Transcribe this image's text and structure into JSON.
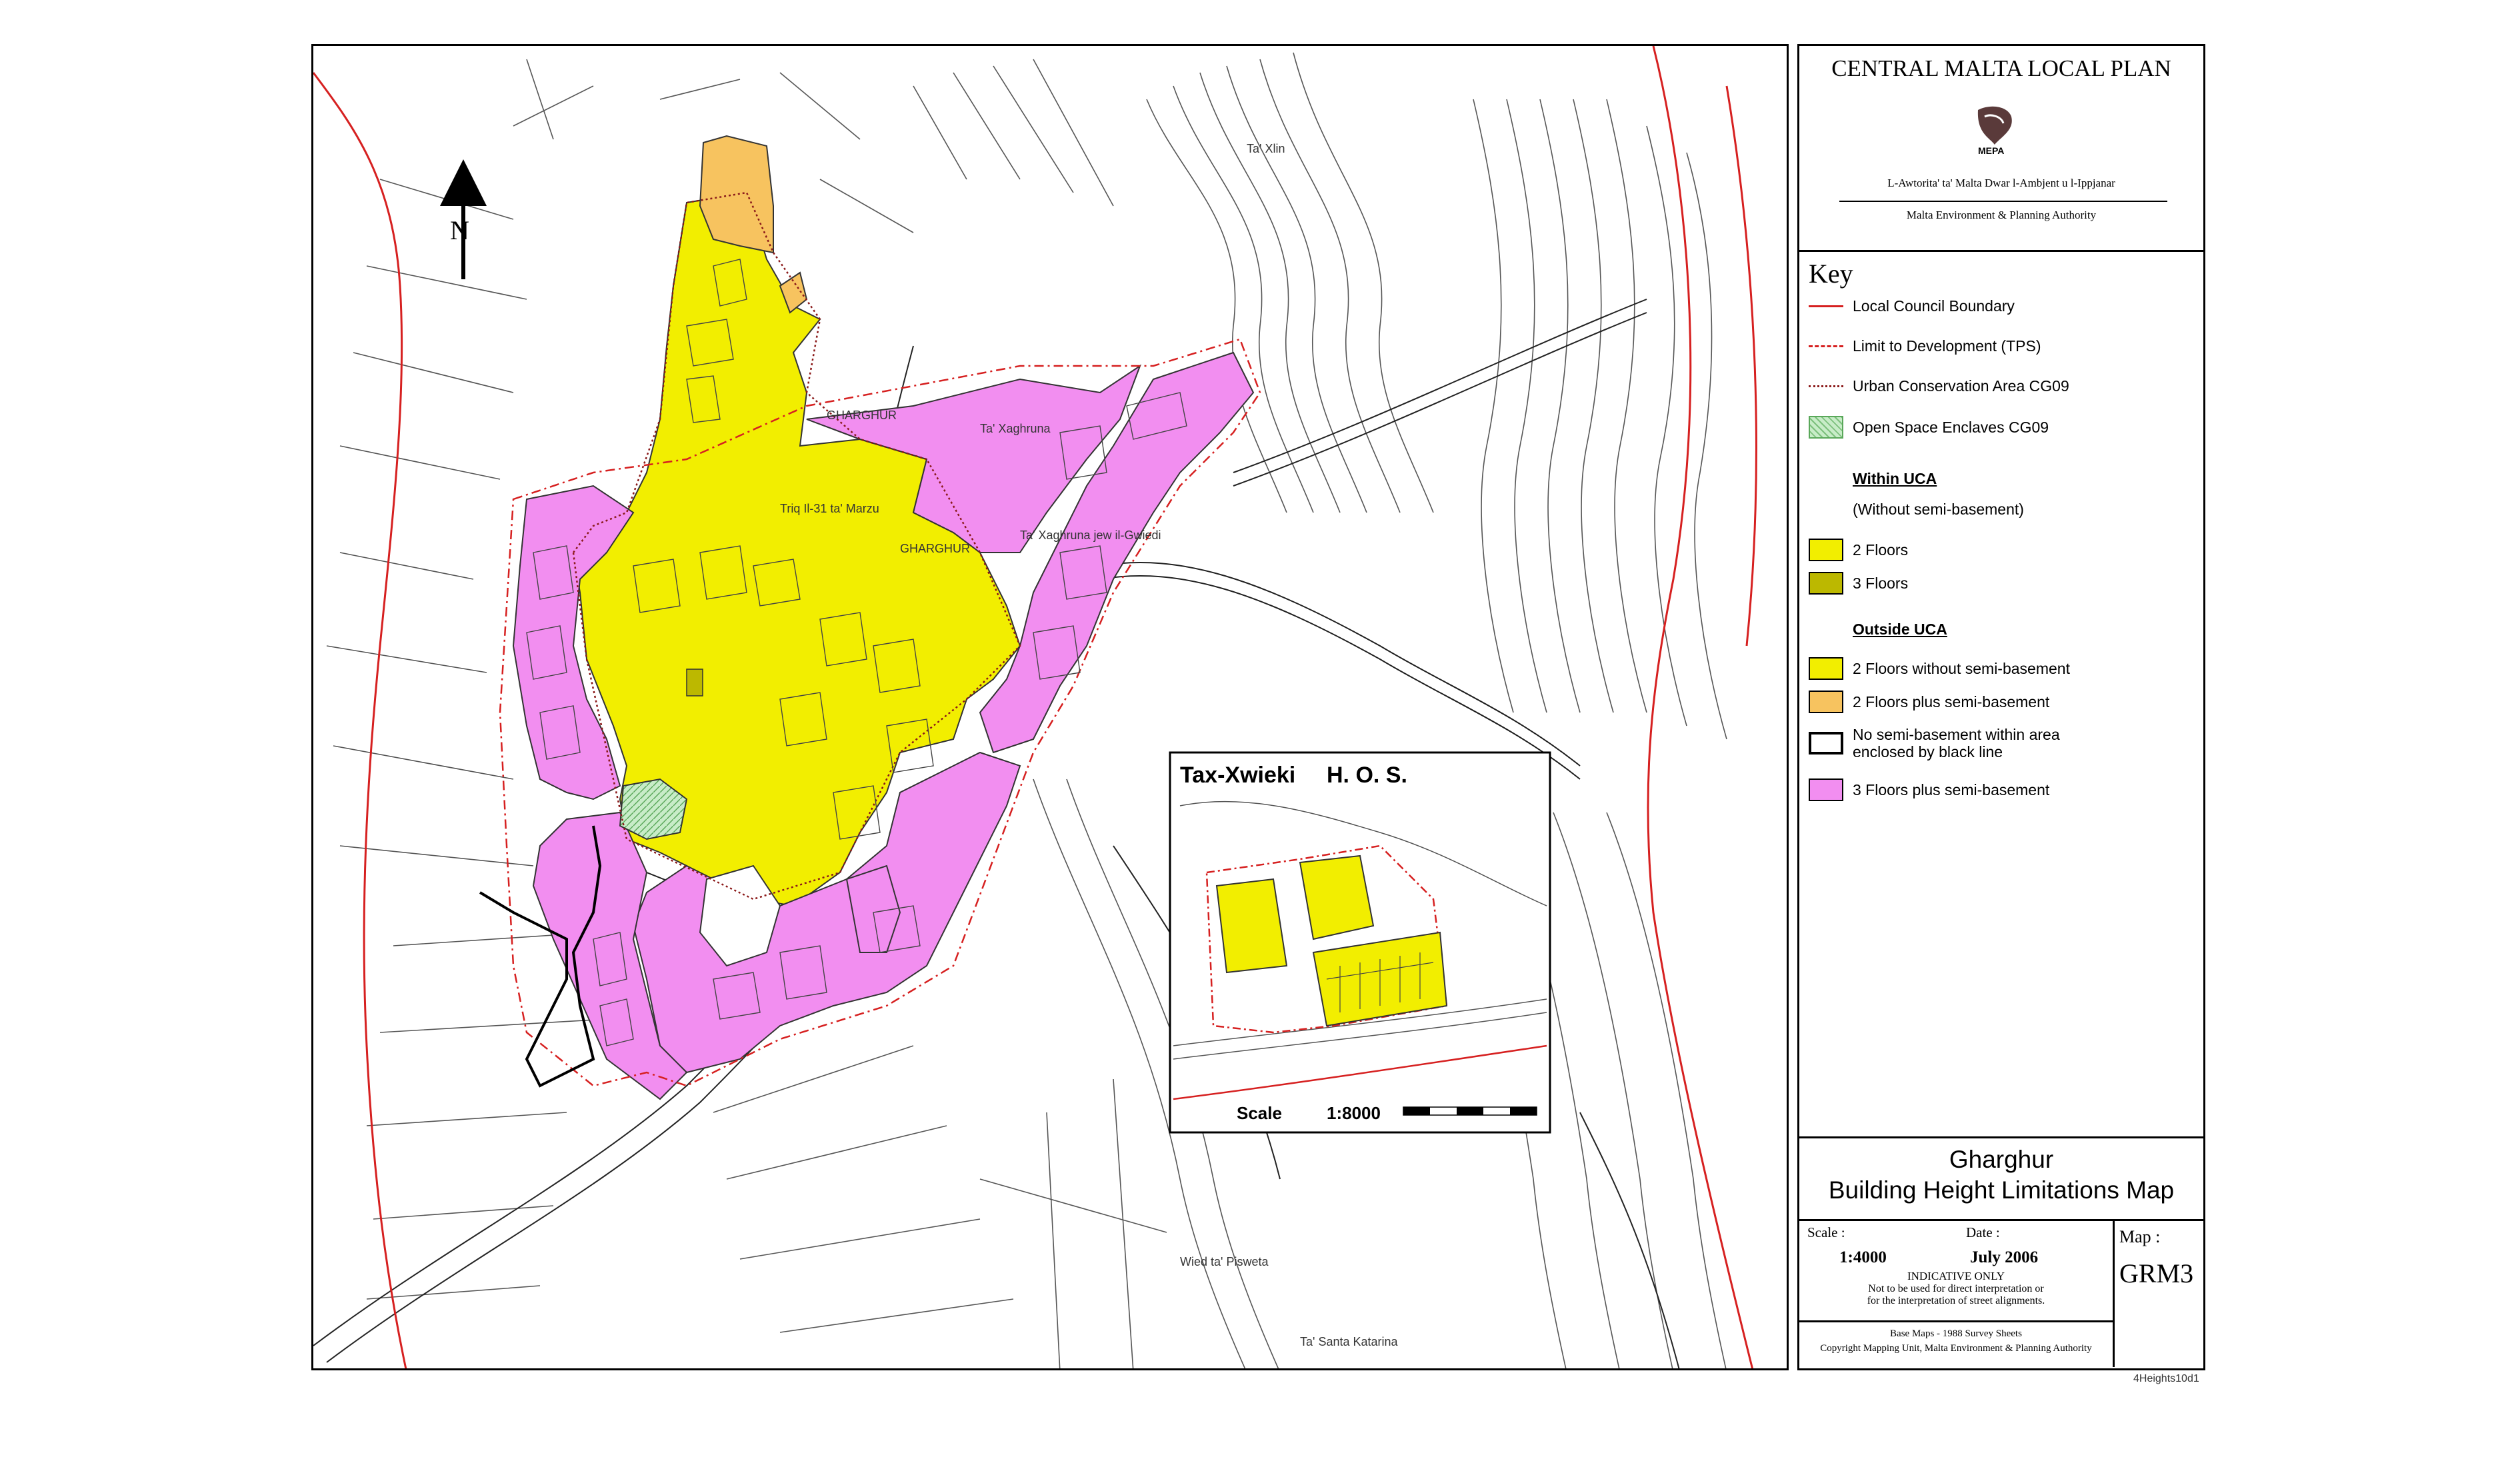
{
  "plan_title": "CENTRAL MALTA LOCAL PLAN",
  "authority": {
    "logo_text": "MEPA",
    "maltese_name": "L-Awtorita' ta' Malta Dwar l-Ambjent u l-Ippjanar",
    "english_name": "Malta Environment & Planning Authority"
  },
  "key": {
    "heading": "Key",
    "lines": [
      {
        "label": "Local Council Boundary",
        "color": "#d62020",
        "style": "solid"
      },
      {
        "label": "Limit to Development (TPS)",
        "color": "#d62020",
        "style": "dashdot"
      },
      {
        "label": "Urban Conservation Area CG09",
        "color": "#8b1a1a",
        "style": "dotted"
      }
    ],
    "open_space": {
      "label": "Open Space Enclaves CG09",
      "color": "#c8ecc8"
    },
    "within_uca": {
      "heading": "Within UCA",
      "note": "(Without semi-basement)",
      "items": [
        {
          "label": "2 Floors",
          "color": "#f2ee00"
        },
        {
          "label": "3 Floors",
          "color": "#bcb800"
        }
      ]
    },
    "outside_uca": {
      "heading": "Outside UCA",
      "items": [
        {
          "label": "2 Floors without semi-basement",
          "color": "#f2ee00"
        },
        {
          "label": "2 Floors plus semi-basement",
          "color": "#f7c35f"
        },
        {
          "label": "No semi-basement within area enclosed by black line",
          "color": "#ffffff"
        },
        {
          "label": "3 Floors plus semi-basement",
          "color": "#f28ef0"
        }
      ]
    }
  },
  "map_title": {
    "line1": "Gharghur",
    "line2": "Building Height Limitations Map"
  },
  "meta": {
    "scale_label": "Scale :",
    "scale_value": "1:4000",
    "date_label": "Date :",
    "date_value": "July 2006",
    "indicative": "INDICATIVE ONLY",
    "disclaimer1": "Not to be used for direct interpretation or",
    "disclaimer2": "for the interpretation of street alignments.",
    "map_label": "Map :",
    "map_code": "GRM3"
  },
  "footer": {
    "line1": "Base Maps - 1988 Survey Sheets",
    "line2": "Copyright Mapping Unit, Malta Environment & Planning Authority"
  },
  "file_ref": "4Heights10d1",
  "map": {
    "north_label": "N",
    "place_labels": [
      "GHARGHUR",
      "GHARGHUR",
      "Ta' Xaghruna",
      "Ta' Xaghruna jew il-Gwiedi",
      "Ta' Xlin",
      "Wied ta' Pisweta",
      "Ta' Santa Katarina",
      "Triq Il-31 ta' Marzu"
    ],
    "inset": {
      "title": "Tax-Xwieki",
      "subtitle": "H. O. S.",
      "scale_label": "Scale",
      "scale_value": "1:8000"
    }
  },
  "colors": {
    "yellow": "#f2ee00",
    "orange": "#f7c35f",
    "pink": "#f28ef0",
    "boundary_red": "#d62020"
  }
}
